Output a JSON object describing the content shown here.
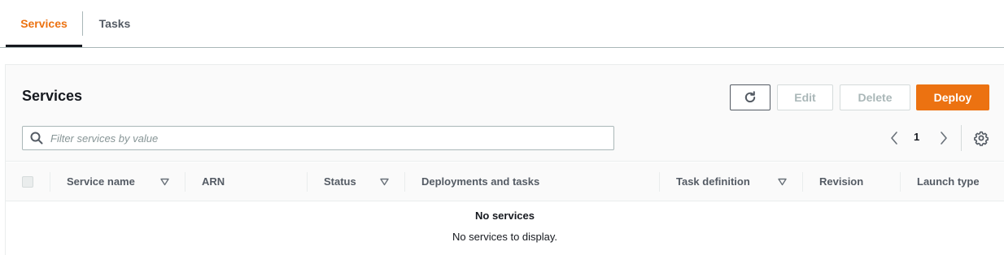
{
  "tabs": [
    {
      "label": "Services",
      "active": true
    },
    {
      "label": "Tasks",
      "active": false
    }
  ],
  "panel": {
    "title": "Services",
    "buttons": {
      "refresh_icon": "refresh-icon",
      "edit": "Edit",
      "delete": "Delete",
      "deploy": "Deploy"
    },
    "search": {
      "placeholder": "Filter services by value",
      "value": ""
    },
    "pagination": {
      "current_page": "1"
    }
  },
  "table": {
    "columns": [
      {
        "label": "Service name",
        "sortable": true
      },
      {
        "label": "ARN",
        "sortable": false
      },
      {
        "label": "Status",
        "sortable": true
      },
      {
        "label": "Deployments and tasks",
        "sortable": false
      },
      {
        "label": "Task definition",
        "sortable": true
      },
      {
        "label": "Revision",
        "sortable": false
      },
      {
        "label": "Launch type",
        "sortable": false
      }
    ],
    "rows": [],
    "empty": {
      "title": "No services",
      "description": "No services to display."
    }
  },
  "colors": {
    "accent": "#ec7211",
    "text": "#16191f",
    "muted": "#545b64",
    "disabled": "#aab7b8"
  }
}
